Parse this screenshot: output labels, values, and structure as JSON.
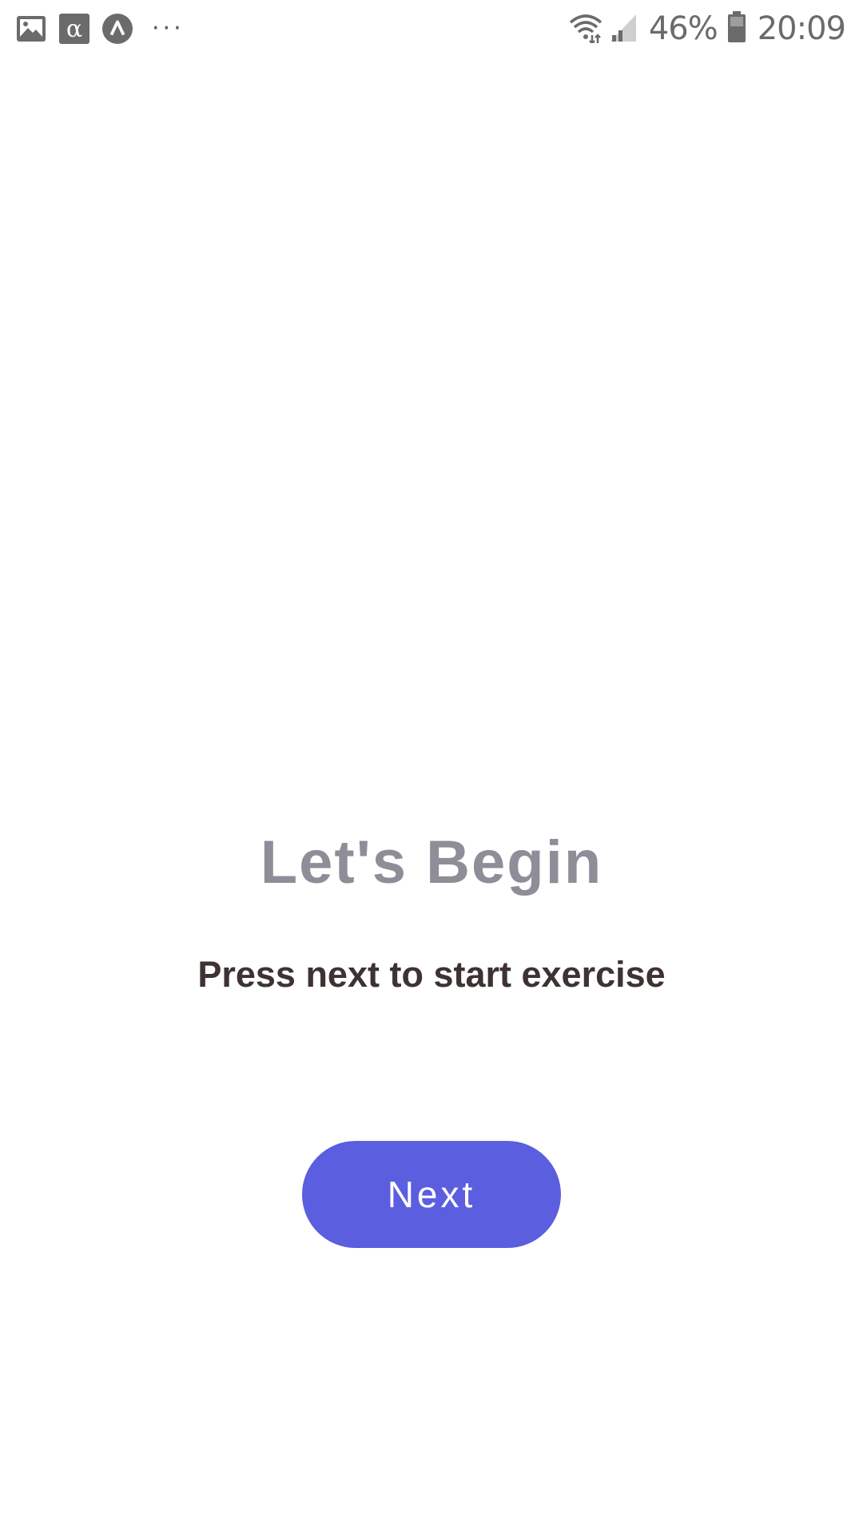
{
  "status_bar": {
    "icons_left": [
      "gallery-icon",
      "alpha-icon",
      "caret-icon"
    ],
    "overflow": "···",
    "battery_percent": "46%",
    "time": "20:09"
  },
  "main": {
    "title": "Let's Begin",
    "subtitle": "Press next to start exercise",
    "next_label": "Next"
  },
  "colors": {
    "accent": "#5b5ede",
    "title": "#8e8e98",
    "subtitle": "#3e3232"
  }
}
